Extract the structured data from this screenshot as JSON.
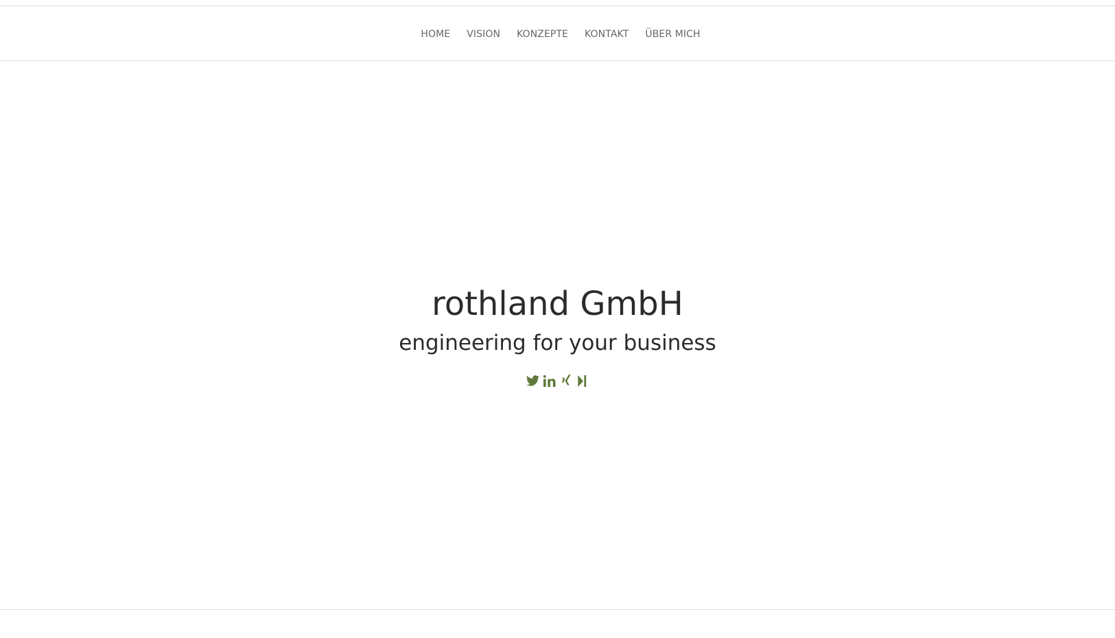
{
  "nav": {
    "items": [
      {
        "label": "HOME"
      },
      {
        "label": "VISION"
      },
      {
        "label": "KONZEPTE"
      },
      {
        "label": "KONTAKT"
      },
      {
        "label": "ÜBER MICH"
      }
    ]
  },
  "hero": {
    "title": "rothland GmbH",
    "subtitle": "engineering for your business",
    "social": [
      {
        "icon": "twitter-icon"
      },
      {
        "icon": "linkedin-icon"
      },
      {
        "icon": "xing-icon"
      },
      {
        "icon": "medium-icon"
      }
    ]
  },
  "colors": {
    "accent": "#5f7a3a",
    "text": "#2b2b2b",
    "nav_text": "#666666",
    "rule": "#dcdcdc"
  }
}
